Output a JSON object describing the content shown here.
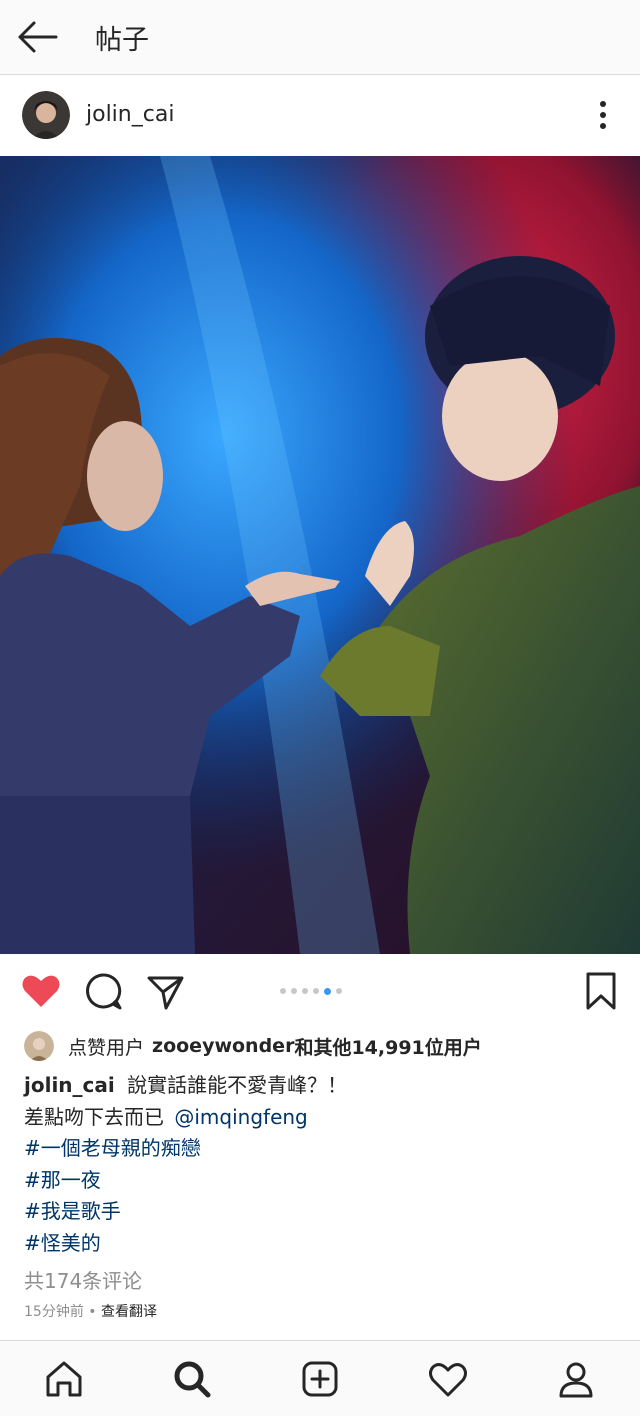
{
  "topbar": {
    "title": "帖子"
  },
  "post": {
    "username": "jolin_cai",
    "likes": {
      "prefix": "点赞用户",
      "user": "zooeywonder",
      "suffix": "和其他14,991位用户"
    },
    "caption": {
      "author": "jolin_cai",
      "line1": "說實話誰能不愛青峰？！",
      "line2_text": "差點吻下去而已",
      "mention": "@imqingfeng",
      "hashtags": [
        "#一個老母親的痴戀",
        "#那一夜",
        "#我是歌手",
        "#怪美的"
      ]
    },
    "comments_link": "共174条评论",
    "time": "15分钟前",
    "separator": "•",
    "translate": "查看翻译",
    "carousel": {
      "total": 6,
      "active_index": 4
    }
  },
  "colors": {
    "heart": "#ed4956",
    "link": "#003569",
    "dot_active": "#3897f0",
    "muted": "#8e8e8e"
  }
}
